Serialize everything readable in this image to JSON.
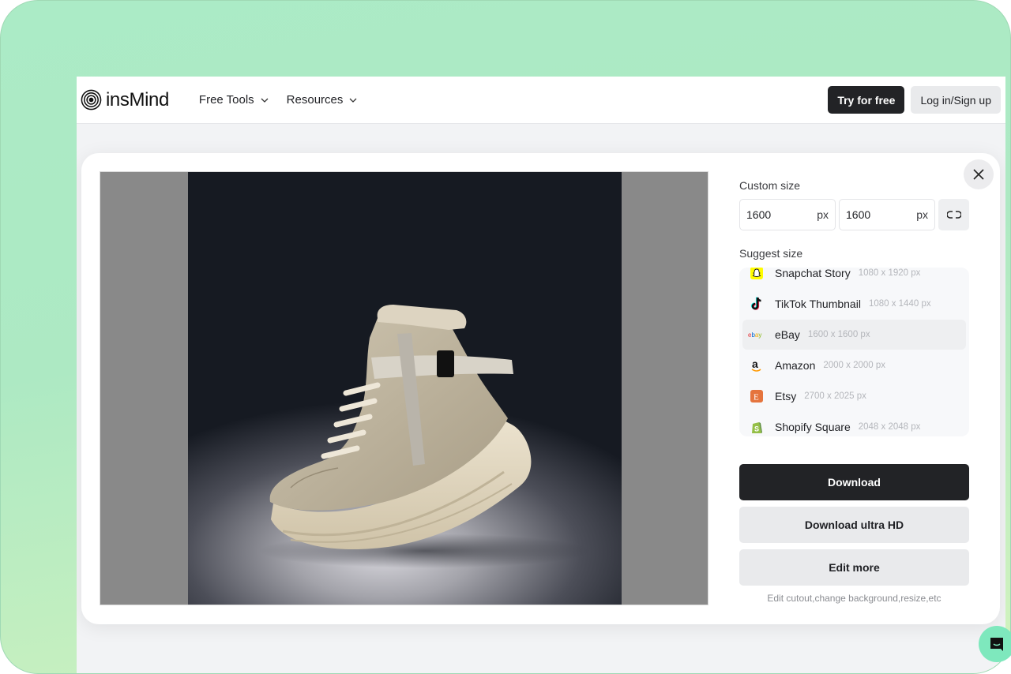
{
  "header": {
    "brand": "insMind",
    "nav": [
      {
        "label": "Free Tools"
      },
      {
        "label": "Resources"
      }
    ],
    "try_label": "Try for free",
    "login_label": "Log in/Sign up"
  },
  "modal": {
    "custom_size_label": "Custom size",
    "width_value": "1600",
    "height_value": "1600",
    "unit": "px",
    "suggest_size_label": "Suggest size",
    "suggestions": [
      {
        "name": "Snapchat Story",
        "dims": "1080 x 1920 px",
        "icon": "snapchat-icon",
        "selected": false
      },
      {
        "name": "TikTok Thumbnail",
        "dims": "1080 x 1440 px",
        "icon": "tiktok-icon",
        "selected": false
      },
      {
        "name": "eBay",
        "dims": "1600 x 1600 px",
        "icon": "ebay-icon",
        "selected": true
      },
      {
        "name": "Amazon",
        "dims": "2000 x 2000 px",
        "icon": "amazon-icon",
        "selected": false
      },
      {
        "name": "Etsy",
        "dims": "2700 x 2025 px",
        "icon": "etsy-icon",
        "selected": false
      },
      {
        "name": "Shopify Square",
        "dims": "2048 x 2048 px",
        "icon": "shopify-icon",
        "selected": false
      }
    ],
    "download_label": "Download",
    "download_uhd_label": "Download ultra HD",
    "edit_more_label": "Edit more",
    "hint": "Edit cutout,change background,resize,etc"
  },
  "colors": {
    "primary_dark": "#222326",
    "secondary_button": "#e9eaec",
    "frame_green": "#abebc6",
    "chat_green": "#7ee8bd"
  }
}
